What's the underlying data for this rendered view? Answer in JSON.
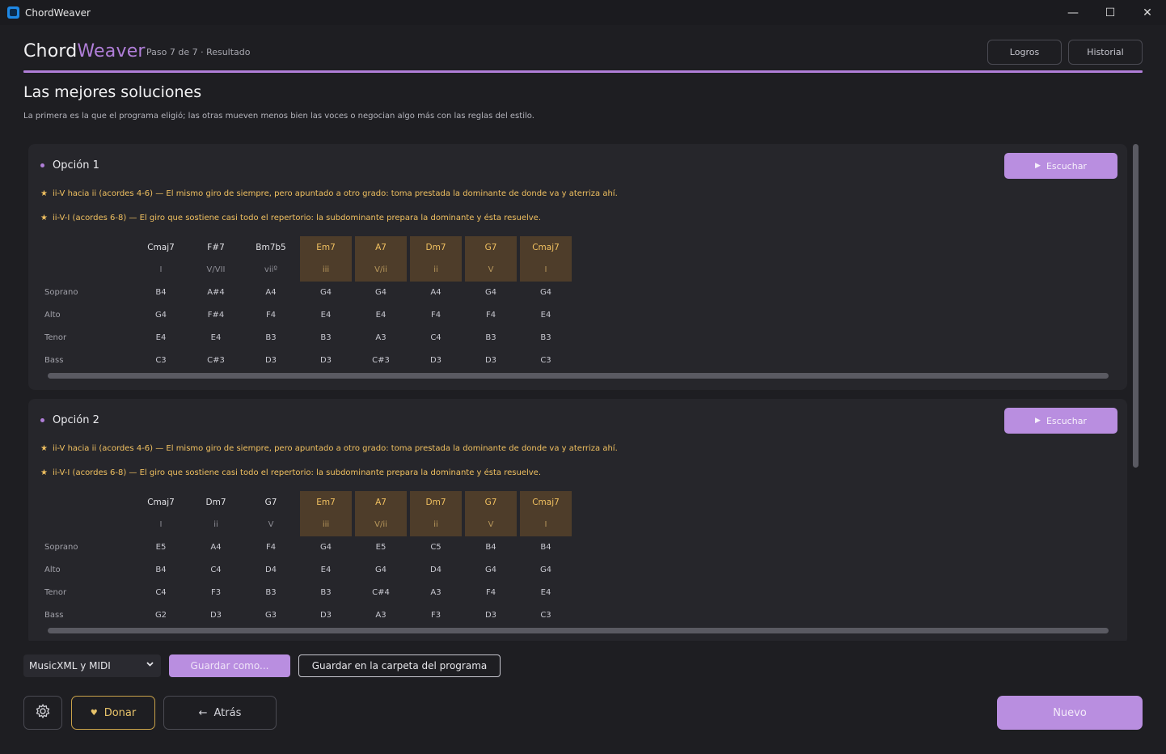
{
  "window": {
    "title": "ChordWeaver",
    "controls": {
      "minimize": "—",
      "maximize": "☐",
      "close": "✕"
    }
  },
  "header": {
    "brand_part1": "Chord",
    "brand_part2": "Weaver",
    "step": "Paso 7 de 7 · Resultado",
    "achievements_label": "Logros",
    "history_label": "Historial"
  },
  "main": {
    "title": "Las mejores soluciones",
    "subtitle": "La primera es la que el programa eligió; las otras mueven menos bien las voces o negocian algo más con las reglas del estilo.",
    "listen_label": "Escuchar",
    "voice_labels": [
      "Soprano",
      "Alto",
      "Tenor",
      "Bass"
    ],
    "options": [
      {
        "title": "Opción 1",
        "patterns": [
          "ii-V hacia ii  (acordes 4-6) — El mismo giro de siempre, pero apuntado a otro grado: toma prestada la dominante de donde va y aterriza ahí.",
          "ii-V-I  (acordes 6-8) — El giro que sostiene casi todo el repertorio: la subdominante prepara la dominante y ésta resuelve."
        ],
        "chords": [
          "Cmaj7",
          "F#7",
          "Bm7b5",
          "Em7",
          "A7",
          "Dm7",
          "G7",
          "Cmaj7"
        ],
        "romans": [
          "I",
          "V/VII",
          "viiº",
          "iii",
          "V/ii",
          "ii",
          "V",
          "I"
        ],
        "highlighted": [
          false,
          false,
          false,
          true,
          true,
          true,
          true,
          true
        ],
        "voices": [
          [
            "B4",
            "A#4",
            "A4",
            "G4",
            "G4",
            "A4",
            "G4",
            "G4"
          ],
          [
            "G4",
            "F#4",
            "F4",
            "E4",
            "E4",
            "F4",
            "F4",
            "E4"
          ],
          [
            "E4",
            "E4",
            "B3",
            "B3",
            "A3",
            "C4",
            "B3",
            "B3"
          ],
          [
            "C3",
            "C#3",
            "D3",
            "D3",
            "C#3",
            "D3",
            "D3",
            "C3"
          ]
        ]
      },
      {
        "title": "Opción 2",
        "patterns": [
          "ii-V hacia ii  (acordes 4-6) — El mismo giro de siempre, pero apuntado a otro grado: toma prestada la dominante de donde va y aterriza ahí.",
          "ii-V-I  (acordes 6-8) — El giro que sostiene casi todo el repertorio: la subdominante prepara la dominante y ésta resuelve."
        ],
        "chords": [
          "Cmaj7",
          "Dm7",
          "G7",
          "Em7",
          "A7",
          "Dm7",
          "G7",
          "Cmaj7"
        ],
        "romans": [
          "I",
          "ii",
          "V",
          "iii",
          "V/ii",
          "ii",
          "V",
          "I"
        ],
        "highlighted": [
          false,
          false,
          false,
          true,
          true,
          true,
          true,
          true
        ],
        "voices": [
          [
            "E5",
            "A4",
            "F4",
            "G4",
            "E5",
            "C5",
            "B4",
            "B4"
          ],
          [
            "B4",
            "C4",
            "D4",
            "E4",
            "G4",
            "D4",
            "G4",
            "G4"
          ],
          [
            "C4",
            "F3",
            "B3",
            "B3",
            "C#4",
            "A3",
            "F4",
            "E4"
          ],
          [
            "G2",
            "D3",
            "G3",
            "D3",
            "A3",
            "F3",
            "D3",
            "C3"
          ]
        ]
      }
    ]
  },
  "export": {
    "format_selected": "MusicXML y MIDI",
    "save_as_label": "Guardar como...",
    "save_to_program_label": "Guardar en la carpeta del programa"
  },
  "footer": {
    "donate_label": "Donar",
    "back_label": "Atrás",
    "new_label": "Nuevo"
  },
  "colors": {
    "accent": "#b07ed8",
    "button_purple": "#b98ee0",
    "highlight_gold": "#f0c060",
    "highlight_bg": "#4e3d2a",
    "background": "#1e1e22"
  }
}
